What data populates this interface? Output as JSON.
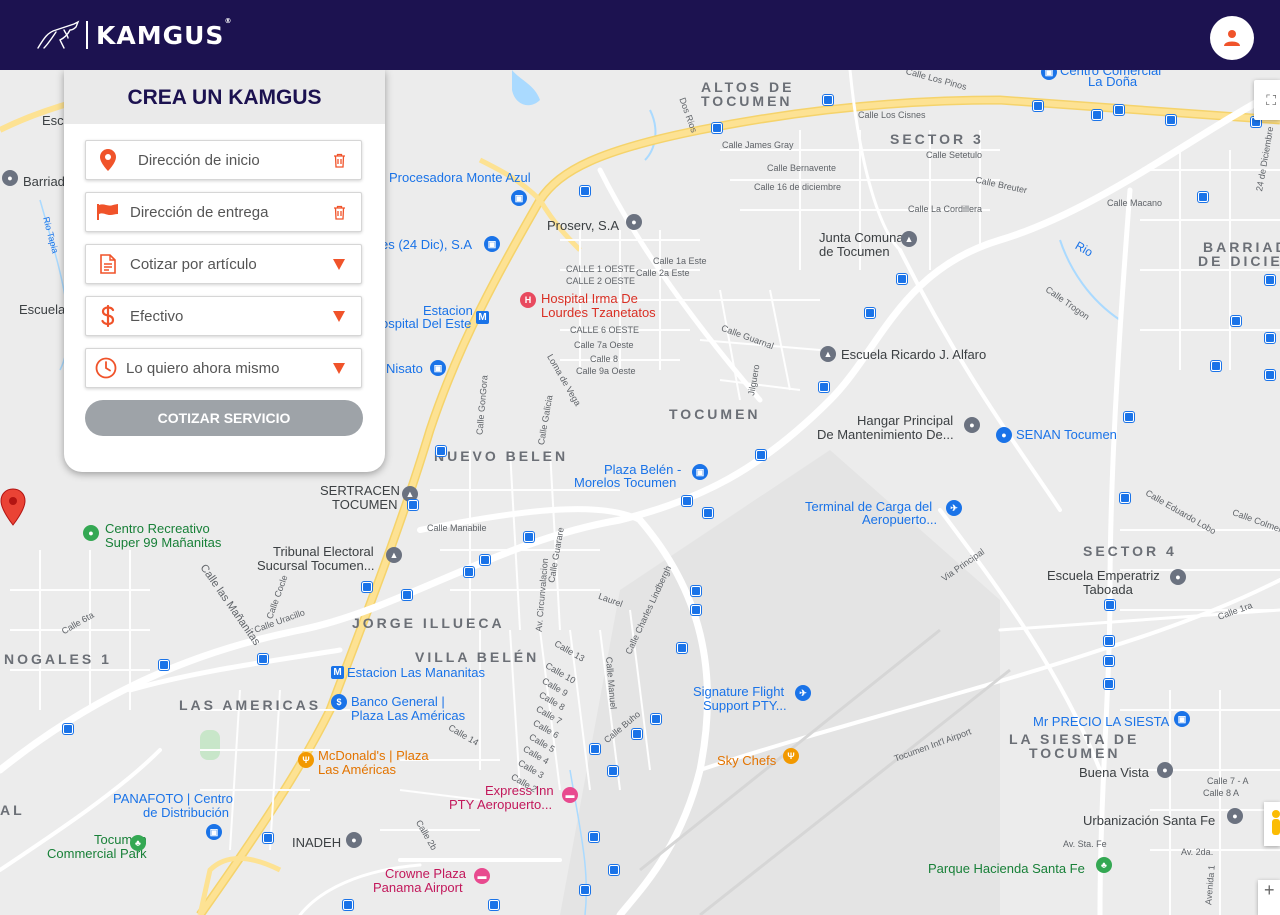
{
  "header": {
    "brand": "KAMGUS",
    "brand_mark": "®",
    "logo_icon": "kangaroo-logo",
    "user_icon": "user-icon",
    "bg_color": "#1c1250"
  },
  "panel": {
    "title": "CREA UN KAMGUS",
    "fields": [
      {
        "placeholder": "Dirección de inicio",
        "icon": "location-pin-icon",
        "action_icon": "trash-icon"
      },
      {
        "placeholder": "Dirección de entrega",
        "icon": "flag-icon",
        "action_icon": "trash-icon"
      },
      {
        "value": "Cotizar por artículo",
        "icon": "document-icon",
        "action_icon": "dropdown-arrow-icon"
      },
      {
        "value": "Efectivo",
        "icon": "dollar-icon",
        "action_icon": "dropdown-arrow-icon"
      },
      {
        "value": "Lo quiero ahora mismo",
        "icon": "clock-icon",
        "action_icon": "dropdown-arrow-icon"
      }
    ],
    "submit_label": "COTIZAR SERVICIO",
    "accent_color": "#f0532a"
  },
  "map": {
    "areas": [
      "ALTOS DE",
      "TOCUMEN",
      "SECTOR 3",
      "BARRIADA",
      "DE DICIEM",
      "TOCUMEN",
      "NUEVO BELEN",
      "SECTOR 4",
      "JORGE ILLUECA",
      "VILLA BELÉN",
      "NOGALES 1",
      "LAS AMERICAS",
      "LA SIESTA DE",
      "TOCUMEN",
      "AL"
    ],
    "pois": {
      "centro_comercial": "Centro Comercial",
      "la_dona": "La Doña",
      "procesadora": "Procesadora Monte Azul",
      "proserv": "Proserv, S.A",
      "dic24": "es (24 Dic), S.A",
      "hospital1": "Hospital Irma De",
      "hospital2": "Lourdes Tzanetatos",
      "estacion1": "Estacion",
      "estacion2": "ospital Del Este",
      "junta1": "Junta Comunal",
      "junta2": "de Tocumen",
      "escuela_ricardo": "Escuela Ricardo J. Alfaro",
      "nisato": "Nisato",
      "hangar1": "Hangar Principal",
      "hangar2": "De Mantenimiento De...",
      "senan": "SENAN Tocumen",
      "plaza_belen1": "Plaza Belén -",
      "plaza_belen2": "Morelos Tocumen",
      "sertracen1": "SERTRACEN",
      "sertracen2": "TOCUMEN",
      "terminal1": "Terminal de Carga del",
      "terminal2": "Aeropuerto...",
      "centro_rec1": "Centro Recreativo",
      "centro_rec2": "Super 99 Mañanitas",
      "tribunal1": "Tribunal Electoral",
      "tribunal2": "Sucursal Tocumen...",
      "escuela_emp1": "Escuela Emperatriz",
      "escuela_emp2": "Taboada",
      "estacion_mananitas": "Estacion Las Mananitas",
      "banco1": "Banco General |",
      "banco2": "Plaza Las Américas",
      "signature1": "Signature Flight",
      "signature2": "Support PTY...",
      "mrprecio": "Mr PRECIO LA SIESTA",
      "mcdonalds1": "McDonald's | Plaza",
      "mcdonalds2": "Las Américas",
      "skychefs": "Sky Chefs",
      "buenavista": "Buena Vista",
      "panafoto1": "PANAFOTO | Centro",
      "panafoto2": "de Distribución",
      "express1": "Express Inn",
      "express2": "PTY Aeropuerto...",
      "urbanizacion": "Urbanización Santa Fe",
      "tocumen_cp1": "Tocumen",
      "tocumen_cp2": "Commercial Park",
      "inadeh": "INADEH",
      "crowne1": "Crowne Plaza",
      "crowne2": "Panama Airport",
      "parque": "Parque Hacienda Santa Fe",
      "escuela_left": "Escuela",
      "barria_left": "Barriad",
      "esc_left": "Esc"
    },
    "streets": [
      "Calle Los Pinos",
      "Calle Los Cisnes",
      "Calle James Gray",
      "Calle Bernavente",
      "Calle 16 de diciembre",
      "Calle Setetulo",
      "Calle Breuter",
      "Calle La Cordillera",
      "Calle Macano",
      "24 de Diciembre",
      "CALLE 1 OESTE",
      "CALLE 2 OESTE",
      "Calle 1a Este",
      "Calle 2a Este",
      "CALLE 6 OESTE",
      "Calle 7a Oeste",
      "Calle 8",
      "Calle 9a Oeste",
      "Calle Guarnal",
      "Jilguero",
      "Calle Manabile",
      "Calle Guarare",
      "Calle Cocle",
      "Calle Uracillo",
      "Calle las Mañanitas",
      "Calle 6ta",
      "Calle 13",
      "Calle 10",
      "Calle 9",
      "Calle 8",
      "Calle 7",
      "Calle 6",
      "Calle 5",
      "Calle 4",
      "Calle 3",
      "Calle 2",
      "Calle 14",
      "Via Principal",
      "Tocumen Int'l Airport",
      "Calle 1ra",
      "Calle 7 - A",
      "Calle 8 A",
      "Av. Sta. Fe",
      "Av. 2da.",
      "Calle Eduardo Lobo",
      "Calle Colmena",
      "Calle Trogon",
      "Rio",
      "Dos Rios",
      "Rio Tapia",
      "Calle GonGora",
      "Calle Galicia",
      "Loma de Vega",
      "Calle Buho",
      "Calle Manuel",
      "Calle Charles Lindbergh",
      "Laurel",
      "Av. Circunvalacion",
      "Calle Las Mañanitas",
      "Avenida 1",
      "Calle 2b"
    ]
  },
  "controls": {
    "fullscreen_icon": "fullscreen-icon",
    "pegman_icon": "pegman-icon",
    "zoom_in_label": "+"
  }
}
